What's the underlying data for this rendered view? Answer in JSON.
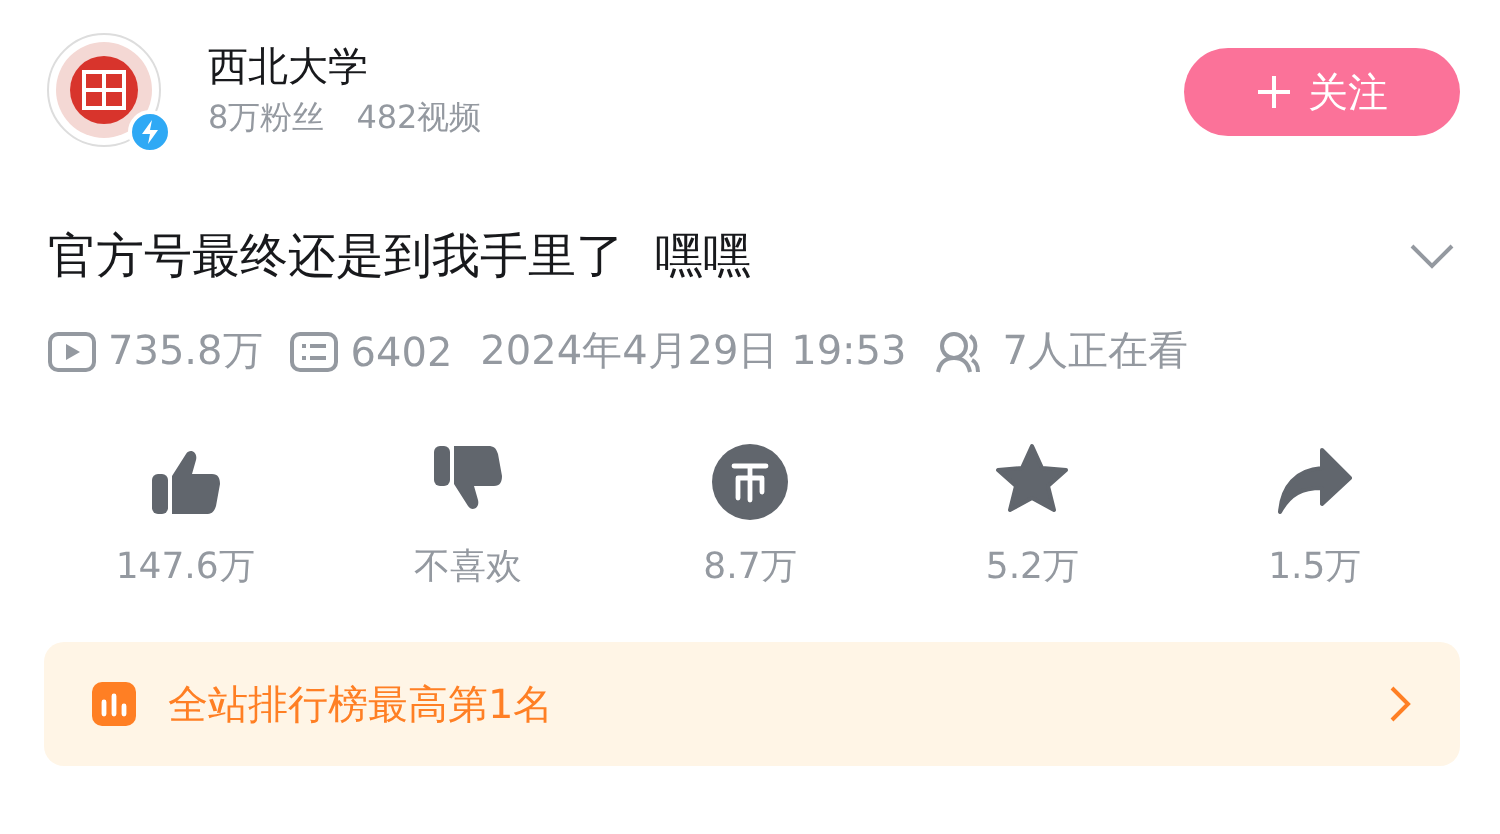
{
  "uploader": {
    "name": "西北大学",
    "followers": "8万粉丝",
    "videos": "482视频",
    "verified": true
  },
  "follow_button": {
    "label": "关注"
  },
  "video": {
    "title": "官方号最终还是到我手里了  嘿嘿",
    "expanded": false
  },
  "stats": [
    {
      "kind": "views",
      "text": "735.8万"
    },
    {
      "kind": "danmaku",
      "text": "6402"
    },
    {
      "kind": "date",
      "text": "2024年4月29日 19:53"
    },
    {
      "kind": "watching",
      "text": "7人正在看"
    }
  ],
  "actions": [
    {
      "kind": "like",
      "label": "147.6万"
    },
    {
      "kind": "dislike",
      "label": "不喜欢"
    },
    {
      "kind": "coin",
      "label": "8.7万"
    },
    {
      "kind": "favorite",
      "label": "5.2万"
    },
    {
      "kind": "share",
      "label": "1.5万"
    }
  ],
  "rank_banner": {
    "text": "全站排行榜最高第1名"
  }
}
